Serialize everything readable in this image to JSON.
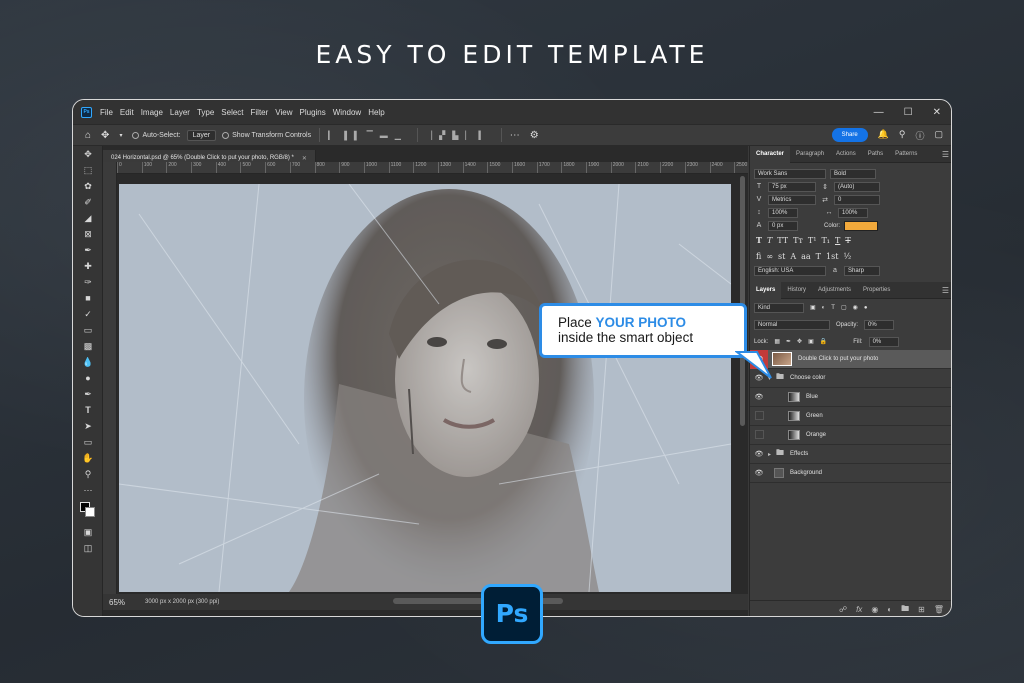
{
  "headline": "EASY TO EDIT TEMPLATE",
  "menubar": {
    "app_icon": "Ps",
    "items": [
      "File",
      "Edit",
      "Image",
      "Layer",
      "Type",
      "Select",
      "Filter",
      "View",
      "Plugins",
      "Window",
      "Help"
    ]
  },
  "options": {
    "auto_select_label": "Auto-Select:",
    "auto_select_value": "Layer",
    "show_transform_label": "Show Transform Controls",
    "share_label": "Share"
  },
  "document": {
    "tab_title": "024 Horizontal.psd @ 65% (Double Click to put your photo, RGB/8) *",
    "ruler_ticks": [
      "0",
      "100",
      "200",
      "300",
      "400",
      "500",
      "600",
      "700",
      "800",
      "900",
      "1000",
      "1100",
      "1200",
      "1300",
      "1400",
      "1500",
      "1600",
      "1700",
      "1800",
      "1900",
      "2000",
      "2100",
      "2200",
      "2300",
      "2400",
      "2500",
      "2600"
    ],
    "zoom": "65%",
    "info": "3000 px x 2000 px (300 ppi)"
  },
  "character_panel": {
    "tabs": [
      "Character",
      "Paragraph",
      "Actions",
      "Paths",
      "Patterns"
    ],
    "font_family": "Work Sans",
    "font_style": "Bold",
    "font_size": "75 px",
    "leading": "(Auto)",
    "kerning": "Metrics",
    "tracking": "0",
    "vertical_scale": "100%",
    "horizontal_scale": "100%",
    "baseline_shift": "0 px",
    "color_label": "Color:",
    "color_value": "#f2a93b",
    "language": "English: USA",
    "antialias": "Sharp"
  },
  "layers_panel": {
    "tabs": [
      "Layers",
      "History",
      "Adjustments",
      "Properties"
    ],
    "filter_kind": "Kind",
    "blend_mode": "Normal",
    "opacity_label": "Opacity:",
    "opacity_value": "0%",
    "lock_label": "Lock:",
    "fill_label": "Fill:",
    "fill_value": "0%",
    "layers": [
      {
        "name": "Double Click to put your photo"
      },
      {
        "name": "Choose color"
      },
      {
        "name": "Blue"
      },
      {
        "name": "Green"
      },
      {
        "name": "Orange"
      },
      {
        "name": "Effects"
      },
      {
        "name": "Background"
      }
    ]
  },
  "callout": {
    "line1_prefix": "Place ",
    "line1_highlight": "YOUR PHOTO",
    "line2": "inside the smart object"
  },
  "badge": "Ps"
}
